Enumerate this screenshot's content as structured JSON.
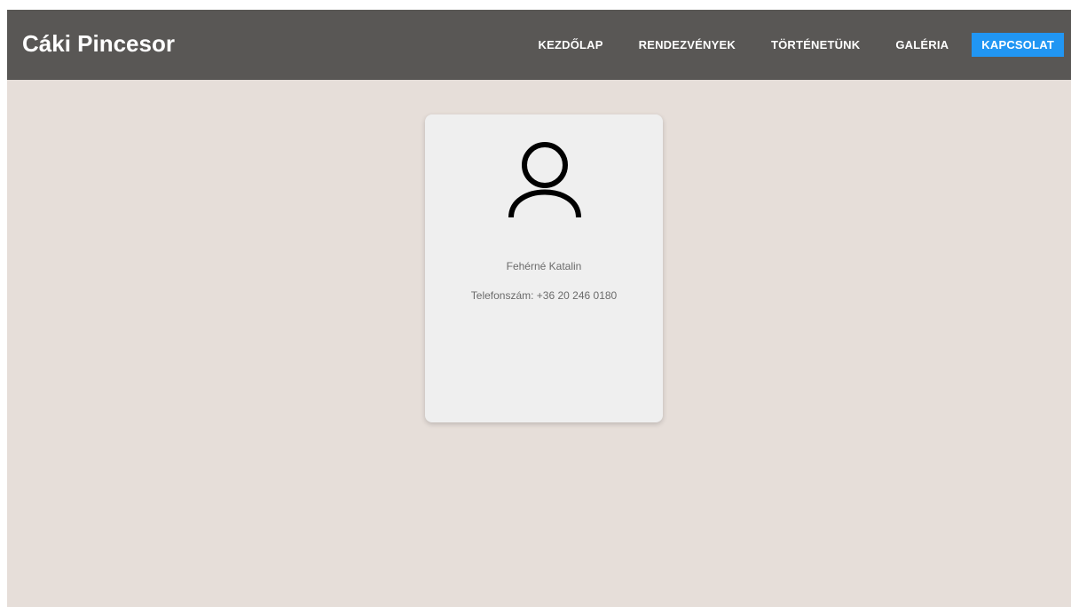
{
  "header": {
    "brand": "Cáki Pincesor"
  },
  "nav": {
    "items": [
      {
        "label": "KEZDŐLAP"
      },
      {
        "label": "RENDEZVÉNYEK"
      },
      {
        "label": "TÖRTÉNETÜNK"
      },
      {
        "label": "GALÉRIA"
      },
      {
        "label": "KAPCSOLAT",
        "active": true
      }
    ]
  },
  "contact_card": {
    "icon": "user-icon",
    "name": "Fehérné Katalin",
    "phone": "Telefonszám: +36 20 246 0180"
  },
  "colors": {
    "navbar_bg": "#595755",
    "page_bg": "#e6ded9",
    "active_nav_bg": "#2196f3",
    "card_bg": "#efefef"
  }
}
